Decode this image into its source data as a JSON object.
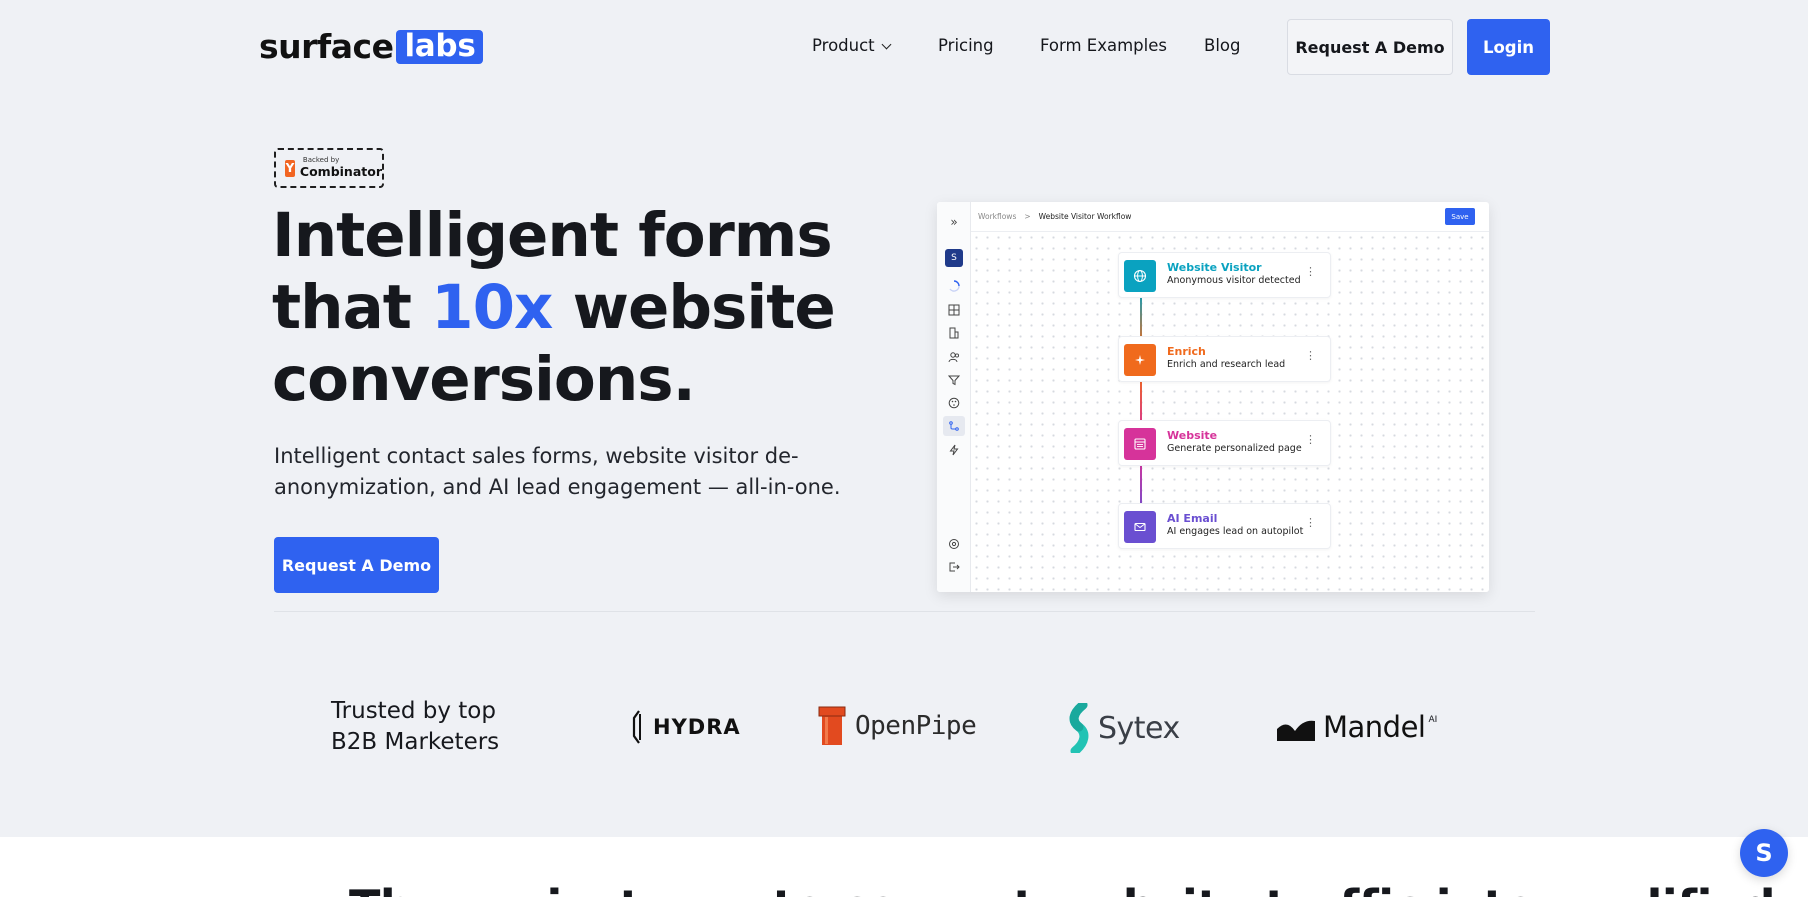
{
  "header": {
    "logo_word1": "surface",
    "logo_word2": "labs",
    "nav": {
      "product": "Product",
      "pricing": "Pricing",
      "form_examples": "Form Examples",
      "blog": "Blog"
    },
    "request_demo": "Request A Demo",
    "login": "Login"
  },
  "hero": {
    "badge_small": "Backed by",
    "badge_big": "Combinator",
    "badge_letter": "Y",
    "title_line1": "Intelligent forms",
    "title_line2_pre": "that ",
    "title_accent": "10x",
    "title_line2_post": " website",
    "title_line3": "conversions.",
    "subtitle": "Intelligent contact sales forms, website visitor de-anonymization, and AI lead engagement — all-in-one.",
    "cta": "Request A Demo"
  },
  "app": {
    "workspace_letter": "S",
    "breadcrumb_root": "Workflows",
    "breadcrumb_sep": ">",
    "breadcrumb_current": "Website Visitor Workflow",
    "save": "Save",
    "nodes": [
      {
        "title": "Website Visitor",
        "desc": "Anonymous visitor detected",
        "color": "#0aa2c0",
        "icon": "globe-icon"
      },
      {
        "title": "Enrich",
        "desc": "Enrich and research lead",
        "color": "#f06a1d",
        "icon": "sparkle-icon"
      },
      {
        "title": "Website",
        "desc": "Generate personalized page",
        "color": "#d6339a",
        "icon": "layout-icon"
      },
      {
        "title": "AI Email",
        "desc": "AI engages lead on autopilot",
        "color": "#6a4fd1",
        "icon": "mail-icon"
      }
    ],
    "menu_glyph": "⋮"
  },
  "trusted": {
    "line1": "Trusted by top",
    "line2": "B2B Marketers",
    "logos": {
      "hydra": "HYDRA",
      "openpipe": "OpenPipe",
      "sytex": "Sytex",
      "mandel": "Mandel",
      "mandel_sup": "AI"
    }
  },
  "bottom_peek": "The easiest way to convert website traffic into qualified",
  "chat_letter": "S",
  "colors": {
    "accent": "#2f62f0",
    "background": "#eff1f5"
  }
}
